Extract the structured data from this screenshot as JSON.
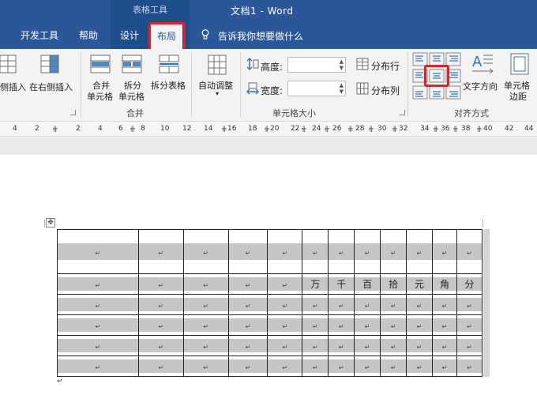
{
  "titlebar": {
    "context_label": "表格工具",
    "doc_title": "文档1  -  Word"
  },
  "tabs": [
    {
      "label": "开发工具"
    },
    {
      "label": "帮助"
    },
    {
      "label": "设计"
    },
    {
      "label": "布局"
    }
  ],
  "tell_me": "告诉我你想要做什么",
  "ribbon": {
    "insert_left_partial": "侧插入",
    "insert_right": "在右侧插入",
    "merge_cells_line1": "合并",
    "merge_cells_line2": "单元格",
    "split_cells_line1": "拆分",
    "split_cells_line2": "单元格",
    "split_table": "拆分表格",
    "group_merge": "合并",
    "autofit": "自动调整",
    "height_label": "高度:",
    "width_label": "宽度:",
    "height_value": "",
    "width_value": "",
    "distribute_rows": "分布行",
    "distribute_cols": "分布列",
    "group_cell_size": "单元格大小",
    "text_direction": "文字方向",
    "cell_margins_line1": "单元格",
    "cell_margins_line2": "边距",
    "group_alignment": "对齐方式"
  },
  "ruler": {
    "numbers": [
      "4",
      "2",
      "2",
      "4",
      "6",
      "8",
      "10",
      "12",
      "14",
      "16",
      "18",
      "20",
      "22",
      "24",
      "26",
      "28",
      "30",
      "32",
      "34",
      "36",
      "38",
      "40",
      "42",
      "44"
    ]
  },
  "table": {
    "columns": [
      "",
      "",
      "",
      "",
      "",
      "",
      "",
      "",
      "",
      "",
      "",
      ""
    ],
    "units": [
      "万",
      "千",
      "百",
      "拾",
      "元",
      "角",
      "分"
    ],
    "cell_mark": "↵"
  },
  "colors": {
    "accent": "#2b579a",
    "highlight": "#e0202a"
  }
}
